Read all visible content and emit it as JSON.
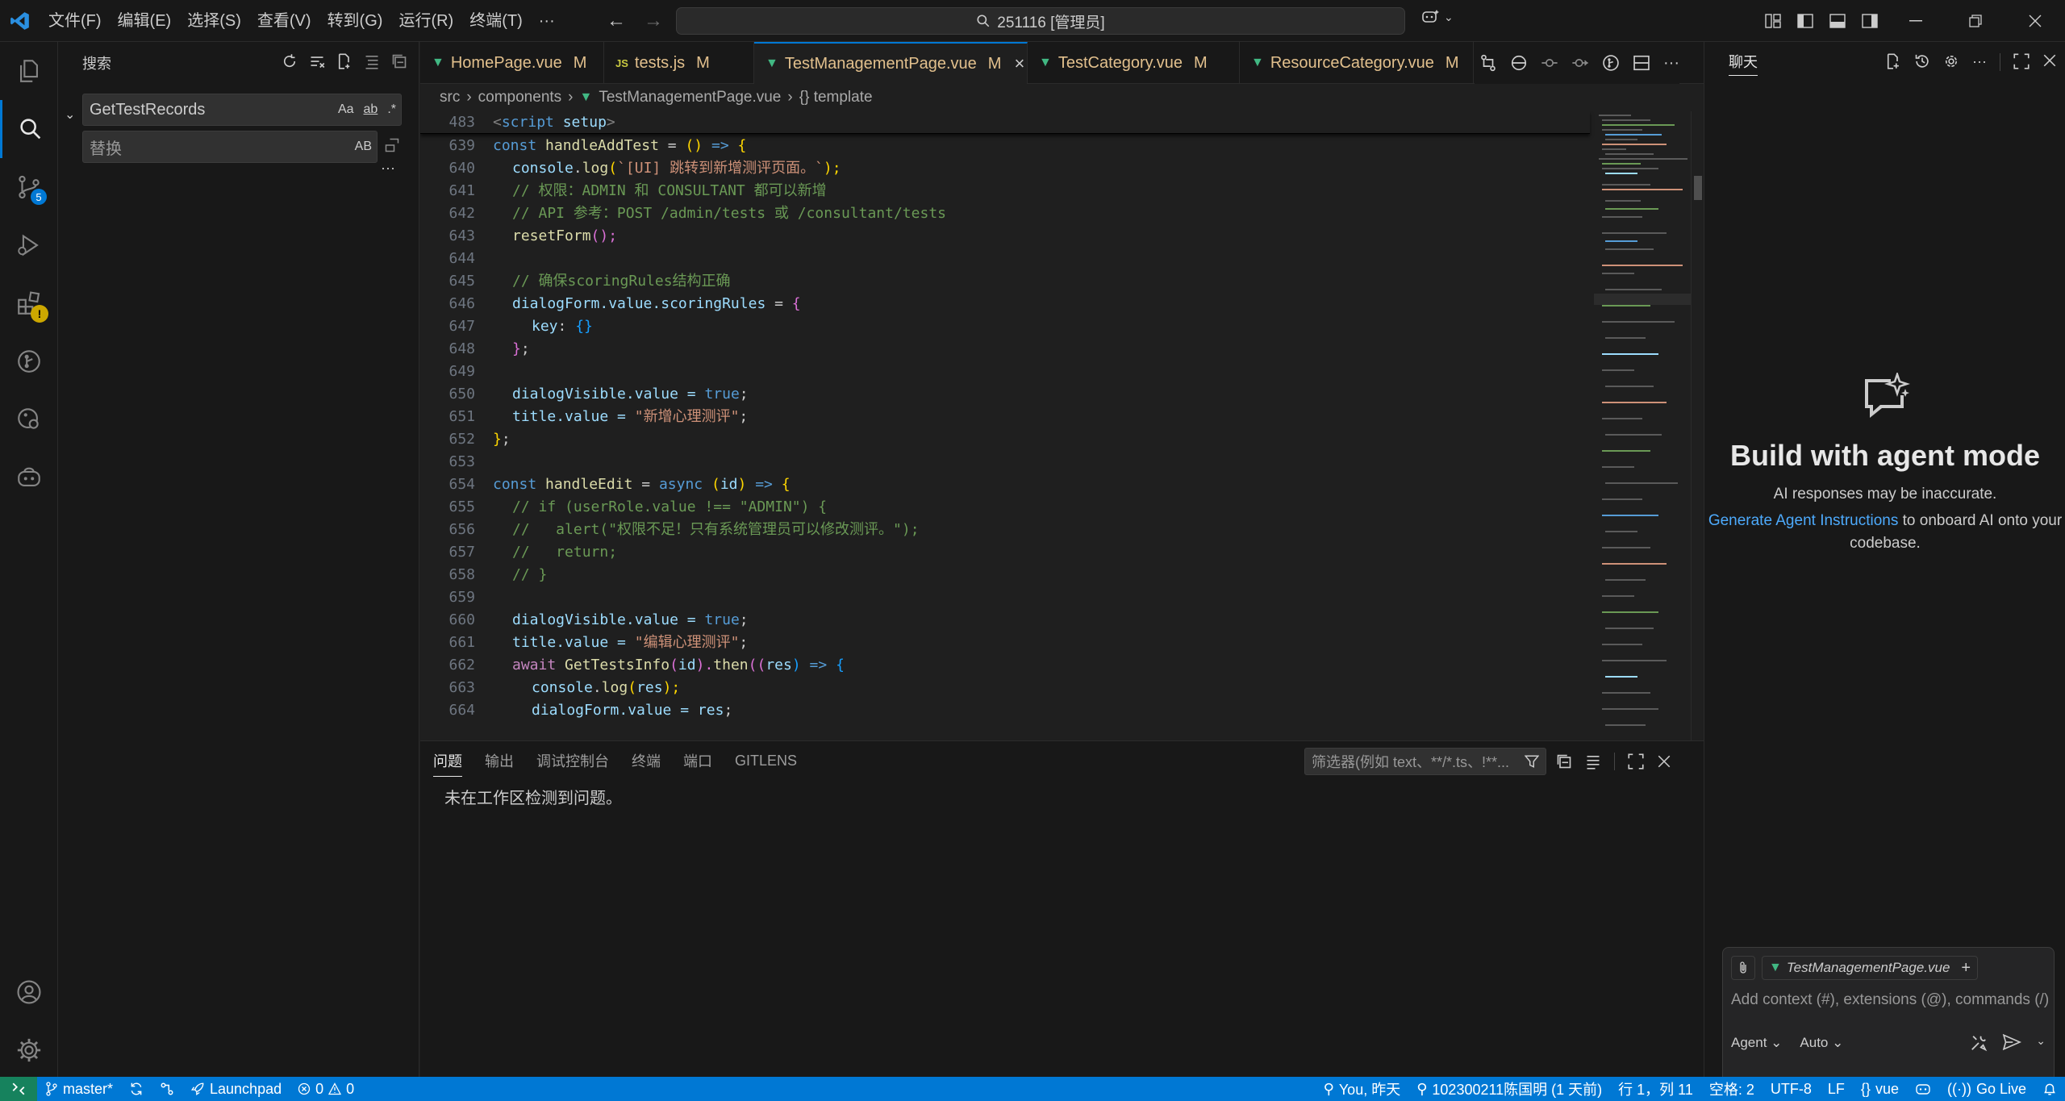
{
  "titlebar": {
    "menu": [
      "文件(F)",
      "编辑(E)",
      "选择(S)",
      "查看(V)",
      "转到(G)",
      "运行(R)",
      "终端(T)",
      "···"
    ],
    "command_center": "251116 [管理员]"
  },
  "sidebar": {
    "title": "搜索",
    "search_value": "GetTestRecords",
    "search_toggles": [
      "Aa",
      "ab",
      ".*"
    ],
    "replace_placeholder": "替换",
    "replace_toggle": "AB",
    "more": "···"
  },
  "activity_badges": {
    "source_control": "5",
    "extensions_warning": "!"
  },
  "tabs": [
    {
      "label": "HomePage.vue",
      "mark": "M",
      "icon": "vue"
    },
    {
      "label": "tests.js",
      "mark": "M",
      "icon": "js"
    },
    {
      "label": "TestManagementPage.vue",
      "mark": "M",
      "icon": "vue",
      "active": true
    },
    {
      "label": "TestCategory.vue",
      "mark": "M",
      "icon": "vue"
    },
    {
      "label": "ResourceCategory.vue",
      "mark": "M",
      "icon": "vue"
    }
  ],
  "breadcrumb": [
    "src",
    "components",
    "TestManagementPage.vue",
    "{} template"
  ],
  "code": {
    "sticky": {
      "ln": "483",
      "text": "<script setup>"
    },
    "lines": [
      {
        "ln": "639"
      },
      {
        "ln": "640"
      },
      {
        "ln": "641"
      },
      {
        "ln": "642"
      },
      {
        "ln": "643"
      },
      {
        "ln": "644"
      },
      {
        "ln": "645"
      },
      {
        "ln": "646"
      },
      {
        "ln": "647"
      },
      {
        "ln": "648"
      },
      {
        "ln": "649"
      },
      {
        "ln": "650"
      },
      {
        "ln": "651"
      },
      {
        "ln": "652"
      },
      {
        "ln": "653"
      },
      {
        "ln": "654"
      },
      {
        "ln": "655"
      },
      {
        "ln": "656"
      },
      {
        "ln": "657"
      },
      {
        "ln": "658"
      },
      {
        "ln": "659"
      },
      {
        "ln": "660"
      },
      {
        "ln": "661"
      },
      {
        "ln": "662"
      },
      {
        "ln": "663"
      },
      {
        "ln": "664"
      }
    ],
    "tokens": {
      "l639": [
        "const",
        "handleAddTest",
        "=",
        "()",
        "=>",
        "{"
      ],
      "l640": [
        "console",
        ".",
        "log",
        "(",
        "`[UI] 跳转到新增测评页面。`",
        ");"
      ],
      "l641": "// 权限：ADMIN 和 CONSULTANT 都可以新增",
      "l642": "// API 参考：POST /admin/tests 或 /consultant/tests",
      "l643": [
        "resetForm",
        "();"
      ],
      "l645": "// 确保scoringRules结构正确",
      "l646": [
        "dialogForm",
        ".value.",
        "scoringRules",
        " = ",
        "{"
      ],
      "l647": [
        "key",
        ": ",
        "{}"
      ],
      "l648": [
        "}",
        ";"
      ],
      "l650": [
        "dialogVisible",
        ".value = ",
        "true",
        ";"
      ],
      "l651": [
        "title",
        ".value = ",
        "\"新增心理测评\"",
        ";"
      ],
      "l652": [
        "}",
        ";"
      ],
      "l654": [
        "const",
        "handleEdit",
        "=",
        "async",
        "(",
        "id",
        ")",
        "=>",
        "{"
      ],
      "l655": "// if (userRole.value !== \"ADMIN\") {",
      "l656": "//   alert(\"权限不足！只有系统管理员可以修改测评。\");",
      "l657": "//   return;",
      "l658": "// }",
      "l660": [
        "dialogVisible",
        ".value = ",
        "true",
        ";"
      ],
      "l661": [
        "title",
        ".value = ",
        "\"编辑心理测评\"",
        ";"
      ],
      "l662": [
        "await",
        "GetTestsInfo",
        "(",
        "id",
        ").",
        "then",
        "((",
        "res",
        ") ",
        "=>",
        " {"
      ],
      "l663": [
        "console",
        ".",
        "log",
        "(",
        "res",
        ");"
      ],
      "l664": [
        "dialogForm",
        ".value = ",
        "res",
        ";"
      ]
    }
  },
  "panel": {
    "tabs": [
      "问题",
      "输出",
      "调试控制台",
      "终端",
      "端口",
      "GITLENS"
    ],
    "filter_placeholder": "筛选器(例如 text、**/*.ts、!**...",
    "message": "未在工作区检测到问题。"
  },
  "chat": {
    "title": "聊天",
    "heading": "Build with agent mode",
    "note": "AI responses may be inaccurate.",
    "cta_link": "Generate Agent Instructions",
    "cta_rest": " to onboard AI onto your codebase.",
    "context_file": "TestManagementPage.vue",
    "input_placeholder": "Add context (#), extensions (@), commands (/)",
    "mode": "Agent",
    "model": "Auto"
  },
  "status": {
    "branch": "master*",
    "launchpad": "Launchpad",
    "errors": "0",
    "warnings": "0",
    "blame": "You, 昨天",
    "commit": "102300211陈国明 (1 天前)",
    "position": "行 1，列 11",
    "spaces": "空格: 2",
    "encoding": "UTF-8",
    "eol": "LF",
    "language": "vue",
    "golive": "Go Live"
  },
  "colors": {
    "accent": "#0078d4",
    "modified": "#e2c08d",
    "vue": "#41b883",
    "link": "#4daafc"
  }
}
